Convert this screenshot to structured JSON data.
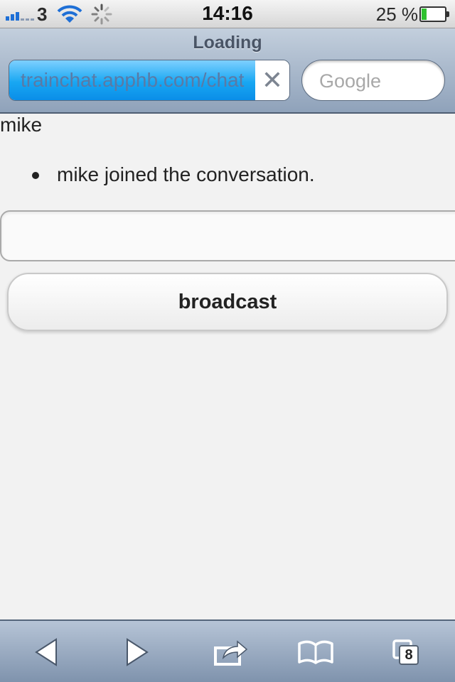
{
  "status_bar": {
    "carrier": "3",
    "time": "14:16",
    "battery_percent_label": "25 %",
    "battery_level": 0.25
  },
  "browser": {
    "page_status": "Loading",
    "url": "trainchat.apphb.com/chat",
    "load_progress": 0.9,
    "search_placeholder": "Google"
  },
  "page": {
    "username": "mike",
    "messages": [
      "mike joined the conversation."
    ],
    "message_input_value": "",
    "broadcast_label": "broadcast"
  },
  "toolbar": {
    "tabs_count": "8",
    "icons": [
      "back-icon",
      "forward-icon",
      "share-icon",
      "bookmarks-icon",
      "tabs-icon"
    ]
  },
  "colors": {
    "accent_blue": "#18a7f2",
    "chrome_blue": "#8fa2ba",
    "battery_green": "#2fc12f"
  }
}
